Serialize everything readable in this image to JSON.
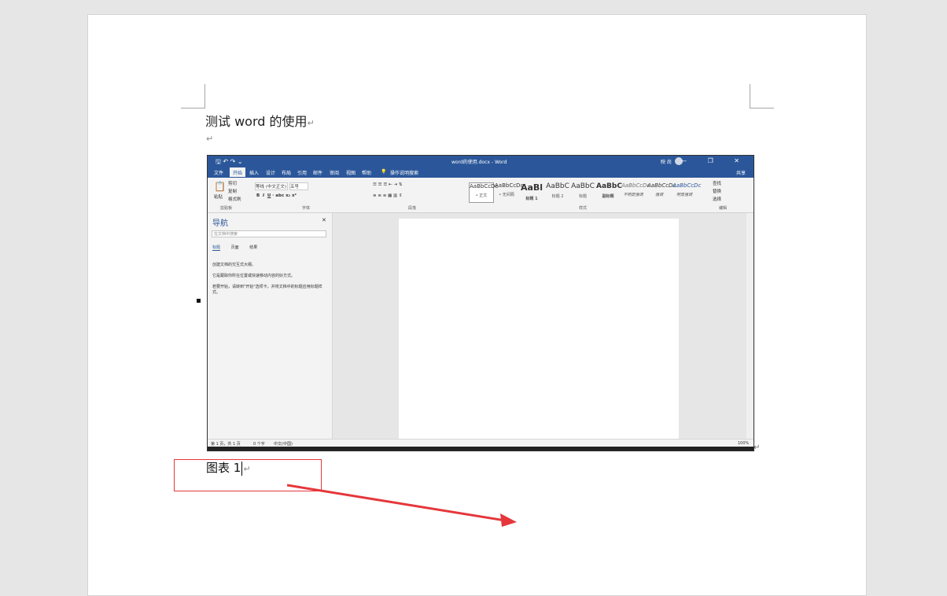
{
  "document": {
    "title_text": "测试 word 的使用",
    "return_mark": "↵",
    "caption_label": "图表",
    "caption_number": "1"
  },
  "embedded_screenshot": {
    "window_title": "word的使用.docx - Word",
    "user_name": "映 尚",
    "quick_access": "🖫 ↶ ↷ ⌄",
    "window_buttons": "— ❐ ✕",
    "tabs": [
      "文件",
      "开始",
      "插入",
      "设计",
      "布局",
      "引用",
      "邮件",
      "审阅",
      "视图",
      "帮助"
    ],
    "tell_me": "操作说明搜索",
    "share": "共享",
    "ribbon": {
      "clipboard_label": "剪贴板",
      "paste": "粘贴",
      "cut": "剪切",
      "copy": "复制",
      "format_painter": "格式刷",
      "font_label": "字体",
      "font_name": "等线 (中文正文)",
      "font_size": "五号",
      "paragraph_label": "段落",
      "styles_label": "样式",
      "editing_label": "编辑",
      "find": "查找",
      "replace": "替换",
      "select": "选择",
      "styles": [
        {
          "sample": "AaBbCcDc",
          "name": "• 正文"
        },
        {
          "sample": "AaBbCcDc",
          "name": "• 无间隔"
        },
        {
          "sample": "AaBl",
          "name": "标题 1"
        },
        {
          "sample": "AaBbC",
          "name": "标题 2"
        },
        {
          "sample": "AaBbC",
          "name": "标题"
        },
        {
          "sample": "AaBbC",
          "name": "副标题"
        },
        {
          "sample": "AaBbCcDc",
          "name": "不明显强调"
        },
        {
          "sample": "AaBbCcDc",
          "name": "强调"
        },
        {
          "sample": "AaBbCcDc",
          "name": "明显强调"
        }
      ]
    },
    "nav": {
      "title": "导航",
      "search_placeholder": "在文档中搜索",
      "tabs": [
        "标题",
        "页面",
        "结果"
      ],
      "line1": "创建文档的交互式大纲。",
      "line2": "它是跟踪你所在位置或快速移动内容的好方式。",
      "line3": "若要开始，请转到\"开始\"选项卡，并将文档中的标题应用标题样式。"
    },
    "status": {
      "page": "第 1 页，共 1 页",
      "words": "0 个字",
      "lang": "中文(中国)",
      "zoom": "100%"
    }
  },
  "colors": {
    "word_blue": "#2b579a",
    "annotation_red": "#e5373b"
  }
}
